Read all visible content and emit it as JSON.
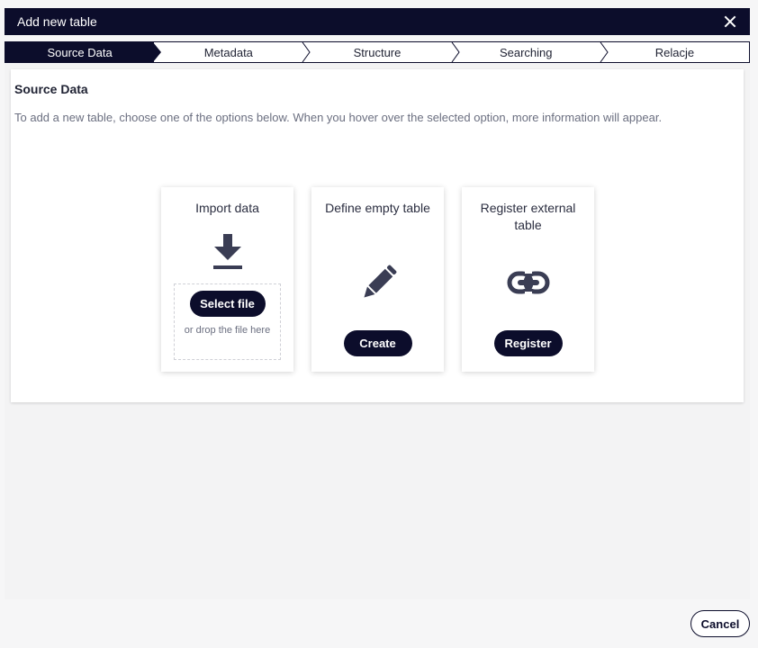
{
  "dialog": {
    "title": "Add new table"
  },
  "steps": [
    {
      "label": "Source Data",
      "active": true
    },
    {
      "label": "Metadata",
      "active": false
    },
    {
      "label": "Structure",
      "active": false
    },
    {
      "label": "Searching",
      "active": false
    },
    {
      "label": "Relacje",
      "active": false
    }
  ],
  "source": {
    "heading": "Source Data",
    "description": "To add a new table, choose one of the options below. When you hover over the selected option, more information will appear."
  },
  "options": {
    "import": {
      "title": "Import data",
      "icon": "download-icon",
      "button": "Select file",
      "hint": "or drop the file here"
    },
    "define": {
      "title": "Define empty table",
      "icon": "pencil-icon",
      "button": "Create"
    },
    "register": {
      "title": "Register external table",
      "icon": "link-icon",
      "button": "Register"
    }
  },
  "footer": {
    "cancel": "Cancel"
  },
  "colors": {
    "primary": "#0c0d2b",
    "icon": "#3a3d54"
  }
}
